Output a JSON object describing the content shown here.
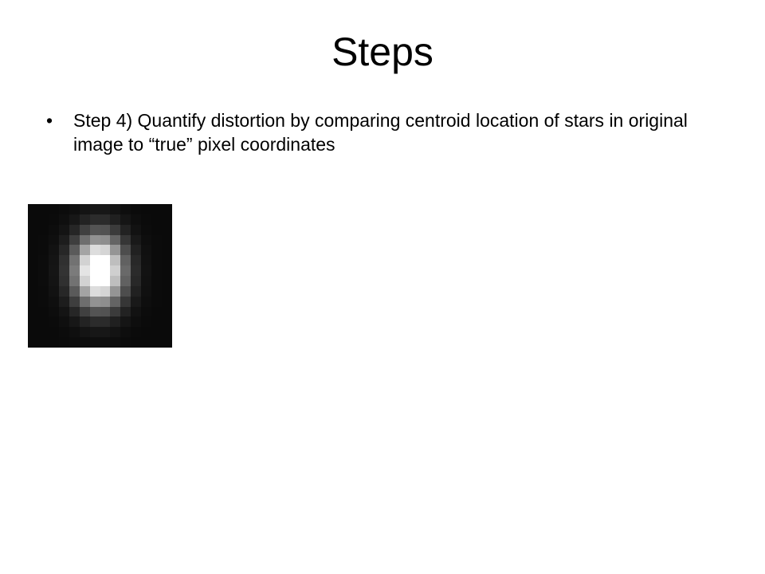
{
  "slide": {
    "title": "Steps",
    "bullets": [
      {
        "marker": "•",
        "text": "Step 4) Quantify distortion by comparing centroid location of stars in original image to “true” pixel coordinates"
      }
    ]
  },
  "star_image": {
    "description_icon": "star-psf-image",
    "colors": {
      "background": "#0a0a0a",
      "peak": "#ffffff"
    }
  }
}
